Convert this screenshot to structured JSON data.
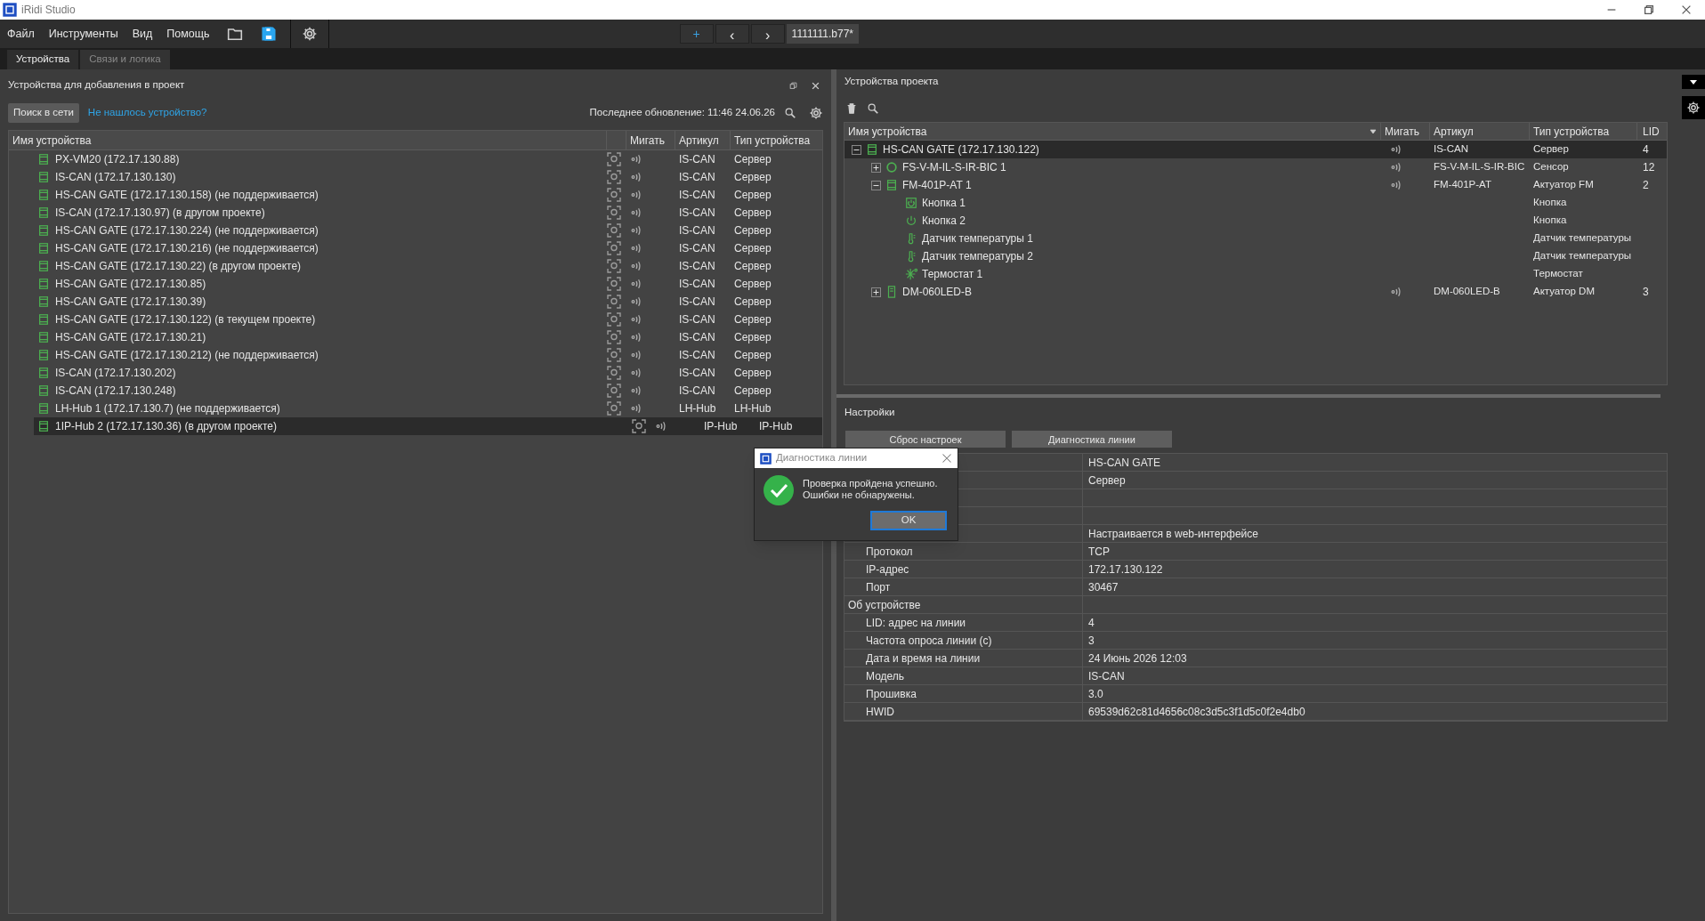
{
  "window": {
    "title": "iRidi Studio"
  },
  "menu": [
    "Файл",
    "Инструменты",
    "Вид",
    "Помощь"
  ],
  "nav": {
    "add": "+",
    "back": "‹",
    "forward": "›",
    "file_tab": "1111111.b77*"
  },
  "tabs": [
    {
      "label": "Устройства",
      "selected": true
    },
    {
      "label": "Связи и логика",
      "selected": false
    }
  ],
  "left_panel": {
    "title": "Устройства для добавления в проект",
    "search_button": "Поиск в сети",
    "help_link": "Не нашлось устройство?",
    "last_update": "Последнее обновление: 11:46 24.06.26",
    "columns": [
      "Имя устройства",
      "Мигать",
      "Артикул",
      "Тип устройства"
    ],
    "rows": [
      {
        "name": "PX-VM20 (172.17.130.88)",
        "article": "IS-CAN",
        "type": "Сервер",
        "selected": false
      },
      {
        "name": "IS-CAN (172.17.130.130)",
        "article": "IS-CAN",
        "type": "Сервер",
        "selected": false
      },
      {
        "name": "HS-CAN GATE (172.17.130.158) (не поддерживается)",
        "article": "IS-CAN",
        "type": "Сервер",
        "selected": false
      },
      {
        "name": "IS-CAN (172.17.130.97) (в другом проекте)",
        "article": "IS-CAN",
        "type": "Сервер",
        "selected": false
      },
      {
        "name": "HS-CAN GATE (172.17.130.224) (не поддерживается)",
        "article": "IS-CAN",
        "type": "Сервер",
        "selected": false
      },
      {
        "name": "HS-CAN GATE (172.17.130.216) (не поддерживается)",
        "article": "IS-CAN",
        "type": "Сервер",
        "selected": false
      },
      {
        "name": "HS-CAN GATE (172.17.130.22) (в другом проекте)",
        "article": "IS-CAN",
        "type": "Сервер",
        "selected": false
      },
      {
        "name": "HS-CAN GATE (172.17.130.85)",
        "article": "IS-CAN",
        "type": "Сервер",
        "selected": false
      },
      {
        "name": "HS-CAN GATE (172.17.130.39)",
        "article": "IS-CAN",
        "type": "Сервер",
        "selected": false
      },
      {
        "name": "HS-CAN GATE (172.17.130.122) (в текущем проекте)",
        "article": "IS-CAN",
        "type": "Сервер",
        "selected": false
      },
      {
        "name": "HS-CAN GATE (172.17.130.21)",
        "article": "IS-CAN",
        "type": "Сервер",
        "selected": false
      },
      {
        "name": "HS-CAN GATE (172.17.130.212) (не поддерживается)",
        "article": "IS-CAN",
        "type": "Сервер",
        "selected": false
      },
      {
        "name": "IS-CAN (172.17.130.202)",
        "article": "IS-CAN",
        "type": "Сервер",
        "selected": false
      },
      {
        "name": "IS-CAN (172.17.130.248)",
        "article": "IS-CAN",
        "type": "Сервер",
        "selected": false
      },
      {
        "name": "LH-Hub 1 (172.17.130.7) (не поддерживается)",
        "article": "LH-Hub",
        "type": "LH-Hub",
        "selected": false
      },
      {
        "name": "1IP-Hub 2 (172.17.130.36) (в другом проекте)",
        "article": "IP-Hub",
        "type": "IP-Hub",
        "selected": true
      }
    ]
  },
  "right_panel": {
    "title": "Устройства проекта",
    "columns": [
      "Имя устройства",
      "Мигать",
      "Артикул",
      "Тип устройства",
      "LID"
    ],
    "tree": [
      {
        "name": "HS-CAN GATE (172.17.130.122)",
        "kind": "module",
        "article": "IS-CAN",
        "type": "Сервер",
        "lid": "4",
        "expanded": true,
        "selected": true,
        "children": [
          {
            "name": "FS-V-M-IL-S-IR-BIC 1",
            "kind": "sensor",
            "article": "FS-V-M-IL-S-IR-BIC",
            "type": "Сенсор",
            "lid": "12",
            "expanded": false,
            "selected": false
          },
          {
            "name": "FM-401P-AT 1",
            "kind": "module",
            "article": "FM-401P-AT",
            "type": "Актуатор FM",
            "lid": "2",
            "expanded": true,
            "selected": false,
            "children": [
              {
                "name": "Кнопка 1",
                "kind": "button",
                "type": "Кнопка",
                "selected": false
              },
              {
                "name": "Кнопка 2",
                "kind": "power",
                "type": "Кнопка",
                "selected": false
              },
              {
                "name": "Датчик температуры 1",
                "kind": "temperature",
                "type": "Датчик температуры",
                "selected": false
              },
              {
                "name": "Датчик температуры 2",
                "kind": "temperature",
                "type": "Датчик температуры",
                "selected": false
              },
              {
                "name": "Термостат 1",
                "kind": "thermostat",
                "type": "Термостат",
                "selected": false
              }
            ]
          },
          {
            "name": "DM-060LED-B",
            "kind": "dimmer",
            "article": "DM-060LED-B",
            "type": "Актуатор DM",
            "lid": "3",
            "expanded": false,
            "selected": false
          }
        ]
      }
    ]
  },
  "settings": {
    "title": "Настройки",
    "buttons": [
      "Сброс настроек",
      "Диагностика линии"
    ],
    "properties": [
      {
        "kind": "row",
        "value": "HS-CAN GATE"
      },
      {
        "kind": "row",
        "value": "Сервер"
      },
      {
        "kind": "row"
      },
      {
        "kind": "group",
        "children": [
          {
            "value": "Настраивается в web-интерфейсе"
          },
          {
            "name": "Протокол",
            "value": "TCP"
          },
          {
            "name": "IP-адрес",
            "value": "172.17.130.122"
          },
          {
            "name": "Порт",
            "value": "30467"
          }
        ]
      },
      {
        "kind": "group",
        "name": "Об устройстве",
        "children": [
          {
            "name": "LID: адрес на линии",
            "value": "4"
          },
          {
            "name": "Частота опроса линии (с)",
            "value": "3"
          },
          {
            "name": "Дата и время на линии",
            "value": "24 Июнь 2026 12:03"
          },
          {
            "name": "Модель",
            "value": "IS-CAN"
          },
          {
            "name": "Прошивка",
            "value": "3.0"
          },
          {
            "name": "HWID",
            "value": "69539d62c81d4656c08c3d5c3f1d5c0f2e4db0"
          }
        ]
      }
    ]
  },
  "dialog": {
    "title": "Диагностика линии",
    "message_lines": [
      "Проверка пройдена успешно.",
      "Ошибки не обнаружены."
    ],
    "ok": "OK"
  }
}
